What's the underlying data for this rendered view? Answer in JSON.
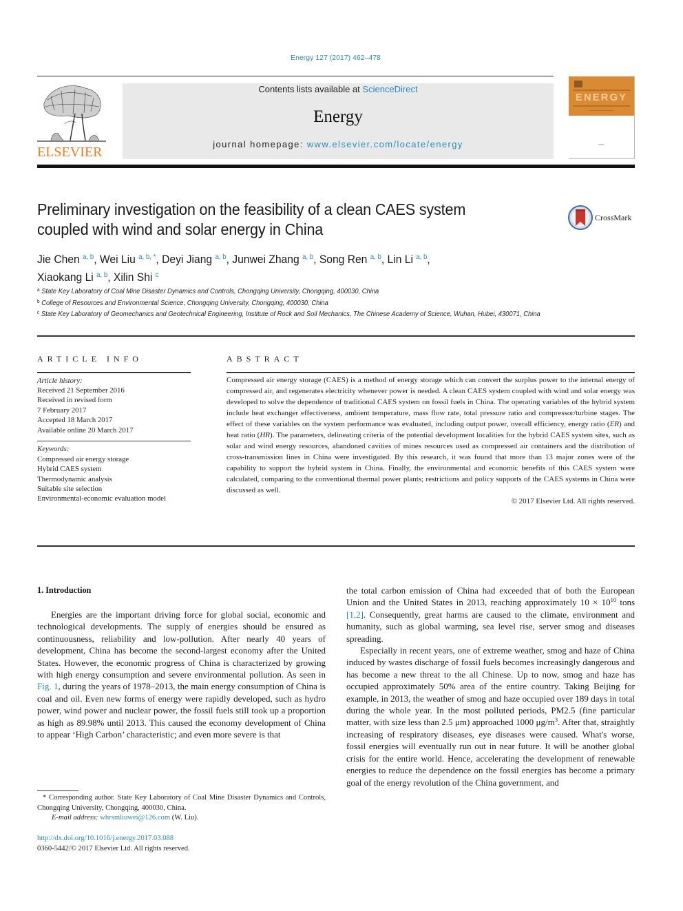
{
  "header": {
    "citation": "Energy 127 (2017) 462–478",
    "contents_prefix": "Contents lists available at ",
    "contents_link": "ScienceDirect",
    "journal_name": "Energy",
    "homepage_prefix": "journal homepage: ",
    "homepage_link": "www.elsevier.com/locate/energy",
    "publisher_logo_text": "ELSEVIER",
    "cover_title": "ENERGY",
    "crossmark_label": "CrossMark"
  },
  "article": {
    "title_line1": "Preliminary investigation on the feasibility of a clean CAES system",
    "title_line2": "coupled with wind and solar energy in China",
    "authors": [
      {
        "name": "Jie Chen",
        "sup": "a, b",
        "sep": ", "
      },
      {
        "name": "Wei Liu",
        "sup": "a, b, *",
        "sep": ", "
      },
      {
        "name": "Deyi Jiang",
        "sup": "a, b",
        "sep": ", "
      },
      {
        "name": "Junwei Zhang",
        "sup": "a, b",
        "sep": ", "
      },
      {
        "name": "Song Ren",
        "sup": "a, b",
        "sep": ", "
      },
      {
        "name": "Lin Li",
        "sup": "a, b",
        "sep": ","
      },
      {
        "name": "Xiaokang Li",
        "sup": "a, b",
        "sep": ", "
      },
      {
        "name": "Xilin Shi",
        "sup": "c",
        "sep": ""
      }
    ],
    "affiliations": [
      {
        "mark": "a",
        "text": "State Key Laboratory of Coal Mine Disaster Dynamics and Controls, Chongqing University, Chongqing, 400030, China"
      },
      {
        "mark": "b",
        "text": "College of Resources and Environmental Science, Chongqing University, Chongqing, 400030, China"
      },
      {
        "mark": "c",
        "text": "State Key Laboratory of Geomechanics and Geotechnical Engineering, Institute of Rock and Soil Mechanics, The Chinese Academy of Science, Wuhan, Hubei, 430071, China"
      }
    ]
  },
  "article_info": {
    "label": "ARTICLE INFO",
    "history_heading": "Article history:",
    "history": [
      "Received 21 September 2016",
      "Received in revised form",
      "7 February 2017",
      "Accepted 18 March 2017",
      "Available online 20 March 2017"
    ],
    "keywords_heading": "Keywords:",
    "keywords": [
      "Compressed air energy storage",
      "Hybrid CAES system",
      "Thermodynamic analysis",
      "Suitable site selection",
      "Environmental-economic evaluation model"
    ]
  },
  "abstract": {
    "label": "ABSTRACT",
    "text_part1": "Compressed air energy storage (CAES) is a method of energy storage which can convert the surplus power to the internal energy of compressed air, and regenerates electricity whenever power is needed. A clean CAES system coupled with wind and solar energy was developed to solve the dependence of traditional CAES system on fossil fuels in China. The operating variables of the hybrid system include heat exchanger effectiveness, ambient temperature, mass flow rate, total pressure ratio and compressor/turbine stages. The effect of these variables on the system performance was evaluated, including output power, overall efficiency, energy ratio (",
    "er": "ER",
    "text_part2": ") and heat ratio (",
    "hr": "HR",
    "text_part3": "). The parameters, delineating criteria of the potential development localities for the hybrid CAES system sites, such as solar and wind energy resources, abandoned cavities of mines resources used as compressed air containers and the distribution of cross-transmission lines in China were investigated. By this research, it was found that more than 13 major zones were of the capability to support the hybrid system in China. Finally, the environmental and economic benefits of this CAES system were calculated, comparing to the conventional thermal power plants; restrictions and policy supports of the CAES systems in China were discussed as well.",
    "copyright": "© 2017 Elsevier Ltd. All rights reserved."
  },
  "introduction": {
    "heading": "1.  Introduction",
    "p1_a": "Energies are the important driving force for global social, economic and technological developments. The supply of energies should be ensured as continuousness, reliability and low-pollution. After nearly 40 years of development, China has become the second-largest economy after the United States. However, the economic progress of China is characterized by growing with high energy consumption and severe environmental pollution. As seen in ",
    "p1_fig_link": "Fig. 1",
    "p1_b": ", during the years of 1978–2013, the main energy consumption of China is coal and oil. Even new forms of energy were rapidly developed, such as hydro power, wind power and nuclear power, the fossil fuels still took up a proportion as high as 89.98% until 2013. This caused the economy development of China to appear ‘High Carbon’ characteristic; and even more severe is that ",
    "p1_c": "the total carbon emission of China had exceeded that of both the European Union and the United States in 2013, reaching approximately 10 × 10",
    "p1_exp": "10",
    "p1_d": " tons ",
    "p1_ref_link": "[1,2]",
    "p1_e": ". Consequently, great harms are caused to the climate, environment and humanity, such as global warming, sea level rise, server smog and diseases spreading.",
    "p2_a": "Especially in recent years, one of extreme weather, smog and haze of China induced by wastes discharge of fossil fuels becomes increasingly dangerous and has become a new threat to the all Chinese. Up to now, smog and haze has occupied approximately 50% area of the entire country. Taking Beijing for example, in 2013, the weather of smog and haze occupied over 189 days in total during the whole year. In the most polluted periods, PM2.5 (fine particular matter, with size less than 2.5 μm) approached 1000 μg/m",
    "p2_exp": "3",
    "p2_b": ". After that, straightly increasing of respiratory diseases, eye diseases were caused. What's worse, fossil energies will eventually run out in near future. It will be another global crisis for the entire world. Hence, accelerating the development of renewable energies to reduce the dependence on the fossil energies has become a primary goal of the energy revolution of the China government, and"
  },
  "footnotes": {
    "corresponding": "* Corresponding author. State Key Laboratory of Coal Mine Disaster Dynamics and Controls, Chongqing University, Chongqing, 400030, China.",
    "email_label": "E-mail address:",
    "email": "whrsmliuwei@126.com",
    "email_suffix": " (W. Liu).",
    "doi": "http://dx.doi.org/10.1016/j.energy.2017.03.088",
    "issn_line": "0360-5442/© 2017 Elsevier Ltd. All rights reserved."
  },
  "colors": {
    "link": "#2a8ab7",
    "elsevier_orange": "#f07d1f",
    "masthead_bg": "#e9e9e9",
    "cover_orange": "#d98a33",
    "crossmark_red": "#c9372c",
    "crossmark_ring": "#3a6ea5"
  }
}
